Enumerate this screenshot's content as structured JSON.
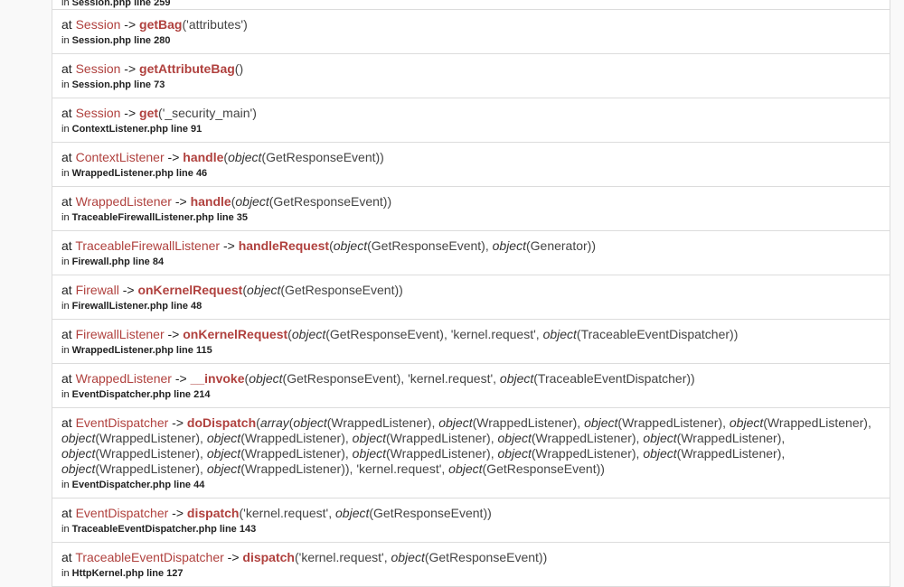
{
  "partial_top": {
    "prefix": "in",
    "location": "Session.php line 259"
  },
  "frames": [
    {
      "class": "Session",
      "method": "getBag",
      "args": [
        {
          "kind": "lit",
          "text": "'attributes'"
        }
      ],
      "file": "Session.php line 280"
    },
    {
      "class": "Session",
      "method": "getAttributeBag",
      "args": [],
      "file": "Session.php line 73"
    },
    {
      "class": "Session",
      "method": "get",
      "args": [
        {
          "kind": "lit",
          "text": "'_security_main'"
        }
      ],
      "file": "ContextListener.php line 91"
    },
    {
      "class": "ContextListener",
      "method": "handle",
      "args": [
        {
          "kind": "obj",
          "type": "object",
          "name": "GetResponseEvent"
        }
      ],
      "file": "WrappedListener.php line 46"
    },
    {
      "class": "WrappedListener",
      "method": "handle",
      "args": [
        {
          "kind": "obj",
          "type": "object",
          "name": "GetResponseEvent"
        }
      ],
      "file": "TraceableFirewallListener.php line 35"
    },
    {
      "class": "TraceableFirewallListener",
      "method": "handleRequest",
      "args": [
        {
          "kind": "obj",
          "type": "object",
          "name": "GetResponseEvent"
        },
        {
          "kind": "obj",
          "type": "object",
          "name": "Generator"
        }
      ],
      "file": "Firewall.php line 84"
    },
    {
      "class": "Firewall",
      "method": "onKernelRequest",
      "args": [
        {
          "kind": "obj",
          "type": "object",
          "name": "GetResponseEvent"
        }
      ],
      "file": "FirewallListener.php line 48"
    },
    {
      "class": "FirewallListener",
      "method": "onKernelRequest",
      "args": [
        {
          "kind": "obj",
          "type": "object",
          "name": "GetResponseEvent"
        },
        {
          "kind": "lit",
          "text": "'kernel.request'"
        },
        {
          "kind": "obj",
          "type": "object",
          "name": "TraceableEventDispatcher"
        }
      ],
      "file": "WrappedListener.php line 115"
    },
    {
      "class": "WrappedListener",
      "method": "__invoke",
      "args": [
        {
          "kind": "obj",
          "type": "object",
          "name": "GetResponseEvent"
        },
        {
          "kind": "lit",
          "text": "'kernel.request'"
        },
        {
          "kind": "obj",
          "type": "object",
          "name": "TraceableEventDispatcher"
        }
      ],
      "file": "EventDispatcher.php line 214"
    },
    {
      "class": "EventDispatcher",
      "method": "doDispatch",
      "args": [
        {
          "kind": "arr",
          "type": "array",
          "count": 16,
          "item_type": "object",
          "item_name": "WrappedListener"
        },
        {
          "kind": "lit",
          "text": "'kernel.request'"
        },
        {
          "kind": "obj",
          "type": "object",
          "name": "GetResponseEvent"
        }
      ],
      "file": "EventDispatcher.php line 44"
    },
    {
      "class": "EventDispatcher",
      "method": "dispatch",
      "args": [
        {
          "kind": "lit",
          "text": "'kernel.request'"
        },
        {
          "kind": "obj",
          "type": "object",
          "name": "GetResponseEvent"
        }
      ],
      "file": "TraceableEventDispatcher.php line 143"
    },
    {
      "class": "TraceableEventDispatcher",
      "method": "dispatch",
      "args": [
        {
          "kind": "lit",
          "text": "'kernel.request'"
        },
        {
          "kind": "obj",
          "type": "object",
          "name": "GetResponseEvent"
        }
      ],
      "file": "HttpKernel.php line 127"
    }
  ],
  "labels": {
    "at": "at",
    "arrow": "->",
    "in": "in"
  }
}
